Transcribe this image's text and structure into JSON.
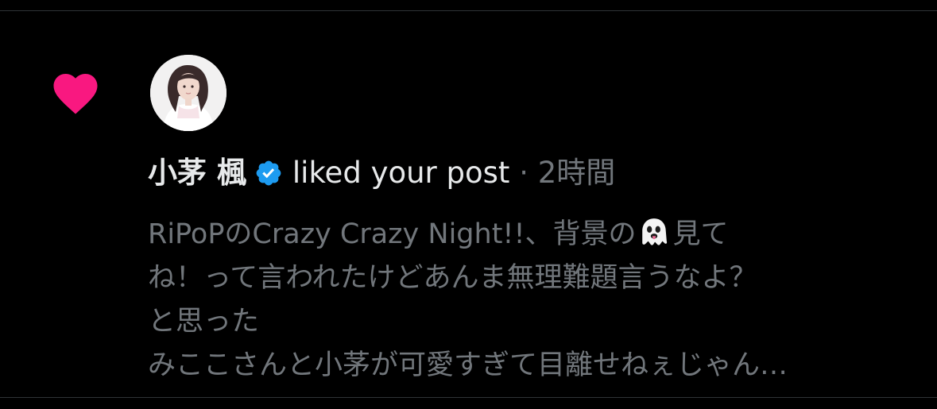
{
  "notification": {
    "icon": "heart-icon",
    "accent_color": "#f91880",
    "user": {
      "name": "小茅 楓",
      "verified": true,
      "badge_color": "#1d9bf0"
    },
    "action": "liked your post",
    "separator": "·",
    "time": "2時間",
    "post_text": {
      "line1_before_emoji": "RiPoPのCrazy Crazy Night!!、背景の",
      "emoji": "ghost-icon",
      "line1_after_emoji": "見て",
      "line2": "ね！って言われたけどあんま無理難題言うなよ？",
      "line3": "と思った",
      "line4": "みここさんと小茅が可愛すぎて目離せねぇじゃん…"
    }
  }
}
